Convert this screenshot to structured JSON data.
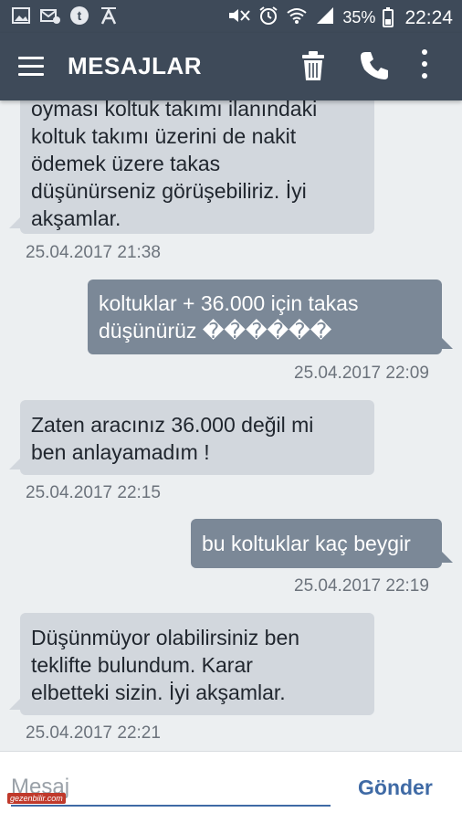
{
  "status_bar": {
    "battery": "35%",
    "time": "22:24",
    "icons": [
      "image-icon",
      "mail-icon",
      "tumblr-icon",
      "a-icon",
      "mute-icon",
      "alarm-icon",
      "wifi-icon",
      "signal-icon",
      "battery-icon"
    ]
  },
  "header": {
    "title": "MESAJLAR",
    "icons": [
      "menu-icon",
      "delete-icon",
      "call-icon",
      "more-icon"
    ]
  },
  "messages": [
    {
      "direction": "in",
      "lines": [
        "oyması koltuk takımı ilanındaki",
        "koltuk takımı üzerini de nakit",
        "ödemek üzere takas",
        "düşünürseniz görüşebiliriz. İyi",
        "akşamlar."
      ],
      "time": "25.04.2017 21:38"
    },
    {
      "direction": "out",
      "lines": [
        "koltuklar + 36.000 için takas",
        "düşünürüz ������"
      ],
      "time": "25.04.2017 22:09"
    },
    {
      "direction": "in",
      "lines": [
        "Zaten aracınız 36.000 değil mi",
        "ben anlayamadım !"
      ],
      "time": "25.04.2017 22:15"
    },
    {
      "direction": "out",
      "lines": [
        "bu koltuklar kaç beygir"
      ],
      "time": "25.04.2017 22:19"
    },
    {
      "direction": "in",
      "lines": [
        "Düşünmüyor olabilirsiniz ben",
        "teklifte bulundum. Karar",
        "elbetteki sizin. İyi akşamlar."
      ],
      "time": "25.04.2017 22:21"
    }
  ],
  "compose": {
    "placeholder": "Mesaj",
    "send_label": "Gönder"
  },
  "watermark": "gezenbilir.com",
  "colors": {
    "app_bar": "#3e4a59",
    "incoming_bubble": "#d2d7dd",
    "outgoing_bubble": "#7b8897",
    "accent": "#3f6aa5"
  }
}
